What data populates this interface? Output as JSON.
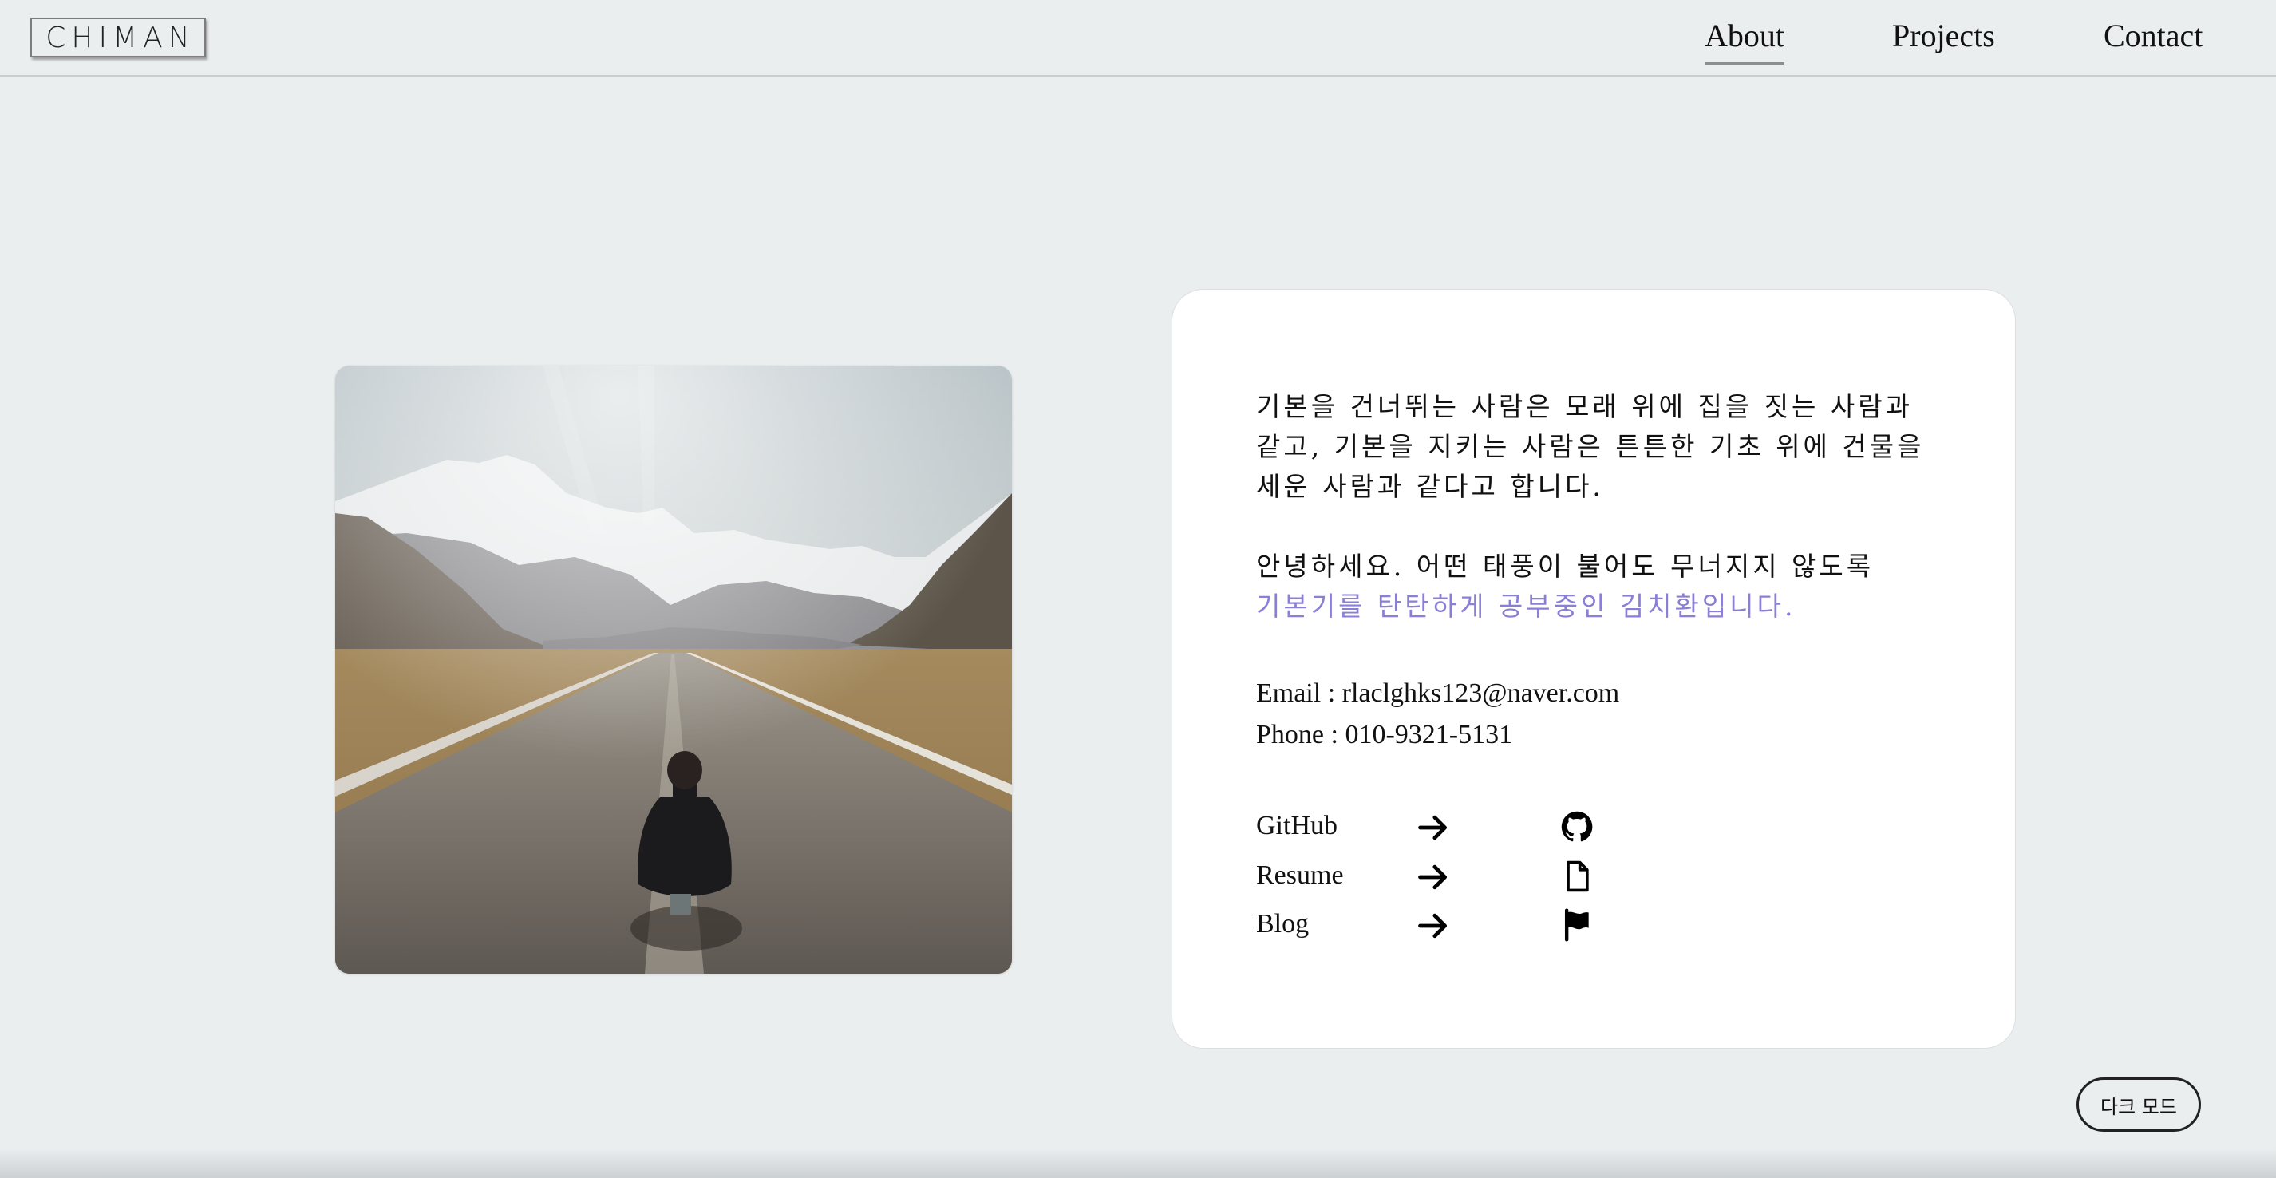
{
  "header": {
    "logo": "CHIMAN",
    "nav": [
      {
        "label": "About",
        "active": true
      },
      {
        "label": "Projects",
        "active": false
      },
      {
        "label": "Contact",
        "active": false
      }
    ]
  },
  "intro": {
    "paragraph1": [
      "기본을 건너뛰는 사람은 모래 위에 집을 짓는 사람과",
      "같고, 기본을 지키는 사람은 튼튼한 기초 위에 건물을",
      "세운 사람과 같다고 합니다."
    ],
    "paragraph2_line1": "안녕하세요. 어떤 태풍이 불어도 무너지지 않도록",
    "paragraph2_line2": "기본기를 탄탄하게 공부중인 김치환입니다."
  },
  "contact": {
    "email": "Email : rlaclghks123@naver.com",
    "phone": "Phone : 010-9321-5131"
  },
  "links": [
    {
      "label": "GitHub",
      "icon": "github-icon"
    },
    {
      "label": "Resume",
      "icon": "file-icon"
    },
    {
      "label": "Blog",
      "icon": "flag-icon"
    }
  ],
  "dark_mode_button": "다크 모드",
  "colors": {
    "background": "#ebeeef",
    "accent": "#8a7fd6",
    "card": "#ffffff"
  }
}
